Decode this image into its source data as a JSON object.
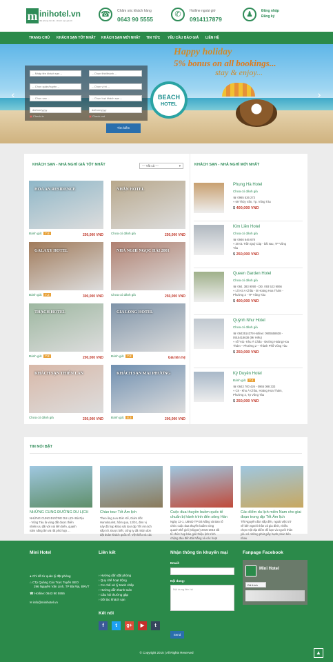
{
  "header": {
    "logo_text": "inihotel.vn",
    "logo_letter": "m",
    "logo_sub": "đặt phòng tốc độ · khách sạn giá tốt",
    "care_label": "Chăm sóc khách hàng",
    "care_phone": "0643 90 5555",
    "hotline_label": "Hotline ngoài giờ",
    "hotline_phone": "0914117879",
    "login": "Đăng nhập",
    "register": "Đăng ký",
    "icons": [
      "phone-icon",
      "mobile-phone-icon",
      "user-icon"
    ]
  },
  "nav": [
    "TRANG CHỦ",
    "KHÁCH SẠN TỐT NHẤT",
    "KHÁCH SẠN MỚI NHẤT",
    "TIN TỨC",
    "YÊU CẦU BÁO GIÁ",
    "LIÊN HỆ"
  ],
  "search": {
    "keyword_placeholder": "-- Nhập tên khách sạn --",
    "province": "-- Chọn tỉnh/thành --",
    "district": "-- Chọn quận/huyện --",
    "location": "-- Chọn vị trí --",
    "stars": "-- Chọn sao --",
    "hotel_type": "-- Chọn loại khách sạn --",
    "checkin_placeholder": "dd/mm/yyyy",
    "checkout_placeholder": "dd/mm/yyyy",
    "checkin_label": "Check-in",
    "checkout_label": "Check-out",
    "button": "Tìm kiếm"
  },
  "banner": {
    "line1": "Happy holiday",
    "line2": "5% bonus on all bookings...",
    "line3": "stay & enjoy...",
    "badge1": "BEACH",
    "badge2": "HOTEL"
  },
  "best": {
    "title": "KHÁCH SẠN - NHÀ NGHỈ GIÁ TỐT NHẤT",
    "filter": "--- Tất cả ---",
    "rate_label": "Đánh giá:",
    "hotels": [
      {
        "name": "HOA AN RESIDENCE",
        "rating": "7.8",
        "price": "250,000 VND",
        "rated": true,
        "color": "#8fb7c8"
      },
      {
        "name": "NHẬN HOTEL",
        "rating_text": "Chưa có đánh giá",
        "price": "250,000 VND",
        "rated": false,
        "color": "#b8a88c"
      },
      {
        "name": "GALAXY HOTEL",
        "rating": "7.2",
        "price": "300,000 VND",
        "rated": true,
        "color": "#a07a5a"
      },
      {
        "name": "NHÀ NGHỈ NGỌC HẢI 2001",
        "rating_text": "Chưa có đánh giá",
        "price": "250,000 VND",
        "rated": false,
        "color": "#b08070"
      },
      {
        "name": "THẠCH HOTEL",
        "rating": "7.8",
        "price": "200,000 VND",
        "rated": true,
        "color": "#9db7a0"
      },
      {
        "name": "GIA LONG HOTEL",
        "rating": "7.8",
        "price": "Giá liên hệ",
        "rated": true,
        "color": "#7e93a8"
      },
      {
        "name": "KHÁCH SẠN THIÊN LAN",
        "rating_text": "Chưa có đánh giá",
        "price": "250,000 VND",
        "rated": false,
        "color": "#d8b8a8"
      },
      {
        "name": "KHÁCH SẠN MAI PHƯƠNG",
        "rating": "8.3",
        "price": "200,000 VND",
        "rated": true,
        "color": "#6f8fb0"
      }
    ]
  },
  "newest": {
    "title": "KHÁCH SẠN - NHÀ NGHỈ MỚI NHẤT",
    "hotels": [
      {
        "name": "Phụng Hà Hotel",
        "rating_text": "Chưa có đánh giá",
        "phone": "0965 526 273",
        "address": "69 Thùy Vân, Tp. Vũng Tàu",
        "address2": "",
        "price": "400,000 VND",
        "color": "#c8a070"
      },
      {
        "name": "Kim Liên Hotel",
        "rating_text": "Chưa có đánh giá",
        "phone": "0946 646 678",
        "address": "30 01 Trần Quý Cáp - bãi sau, TP Vũng",
        "address2": "Tàu",
        "price": "250,000 VND",
        "color": "#b0b8c0"
      },
      {
        "name": "Queen Garden Hotel",
        "rating_text": "Chưa có đánh giá",
        "phone": "064. 383 9090 - DĐ. 093 523 9066",
        "address": "Lô H3 A Châu - Đ Hoàng Hoa Thám -",
        "address2": "Phường 2 - TP Vũng Tàu",
        "price": "400,000 VND",
        "color": "#9fb08a"
      },
      {
        "name": "Quỳnh Như Hotel",
        "rating_text": "Chưa có đánh giá",
        "phone": "0643514379 Hotline: 0905558638 -",
        "phone2": "0915418638 (Mr Hiếu)",
        "address": "số Y41- Khu Á Châu - Đường Hoàng Hoa",
        "address2": "Thám – Phường 2 – Thành Phố Vũng Tàu",
        "price": "250,000 VND",
        "color": "#c0c8d0"
      },
      {
        "name": "Kỳ Duyên Hotel",
        "rating": "7.4",
        "phone": "0643 700 426 - 0965 088 333",
        "address": "C8 - Khu Á Châu, Hoàng Hoa Thám,",
        "address2": "Phường 2, Tp Vũng Tàu",
        "price": "250,000 VND",
        "color": "#a8b8c8"
      }
    ]
  },
  "news": {
    "title": "TIN NỔI BẬT",
    "items": [
      {
        "title": "NHỮNG CUNG ĐƯỜNG DU LỊCH",
        "text": [
          "NHỮNG CUNG ĐƯỜNG DU LỊCH Bà Rịa",
          "- Vũng Tàu là vùng đất được thiên",
          "nhiên ưu đãi với núi liền biển, quanh",
          "năm nắng ấm và rất phù hợp ..."
        ],
        "color": "#5f8f6a"
      },
      {
        "title": "Chào tour Tết Âm lịch",
        "text": [
          "Theo ông Lưu Đức Kế, Giám đốc",
          "Hanoitourist, hôm qua, 12/01, đơn vị",
          "này đã họp khảo sát tour dịp Tết Âm lịch",
          "sắp tới. Được biết, công ty đã nhận đơn",
          "đặt đoàn khách quốc tế. Việt kiều và các"
        ],
        "color": "#8a7a5a"
      },
      {
        "title": "Cuộc đua thuyền buồm quốc tế chuẩn bị hành trình đến sông Hàn",
        "text": [
          "Ngày 12-1, UBND TP Đà Nẵng và Ban tổ",
          "chức cuộc đua thuyền buồm vòng",
          "quanh thế giới (Clipper) 2015-2016 đã",
          "tổ chức họp báo giới thiệu lịch trình",
          "chặng đua đến Đà Nẵng và các hoạt"
        ],
        "color": "#c04a3a"
      },
      {
        "title": "Các điểm du lịch miền Nam cho giai đoạn trong dịp Tết Âm lịch",
        "text": [
          "Tết Nguyên đán sắp đến, ngoài việc trở",
          "về bên người thân và gia đình, nhiều",
          "chọn một địa điểm để bạn và người thân",
          "yêu có những phút giây hạnh phúc bên",
          "nhau"
        ],
        "color": "#c8a860"
      }
    ]
  },
  "footer": {
    "col1_title": "Mini Hotel",
    "col1": [
      "Chỉ đồ từ quản lý đặt phòng",
      "CTy Quảng Cáo Trực Tuyến SEO",
      "296 Nguyễn Văn Linh, TP Bà Rịa, BRVT",
      "Hotline: 0643 90 5555",
      "info@minihotel.vn"
    ],
    "col2_title": "Liên kết",
    "col2": [
      "Hướng dẫn đặt phòng",
      "Quy chế hoạt động",
      "Cơ chế xử lý tranh chấp",
      "Hướng dẫn thanh toán",
      "Câu hỏi thường gặp",
      "Đối tác khách sạn"
    ],
    "social_title": "Kết nối",
    "social": [
      "f",
      "t",
      "g+",
      "▶",
      "t"
    ],
    "social_colors": [
      "#3b5998",
      "#1da1f2",
      "#dd4b39",
      "#c4302b",
      "#35465c"
    ],
    "col3_title": "Nhận thông tin khuyến mại",
    "email_label": "Email:",
    "content_label": "Nội dung:",
    "content_placeholder": "Nội dung liên hệ",
    "send": "Send",
    "col4_title": "Fanpage Facebook",
    "fb_name": "Mini Hotel",
    "fb_liked": "Đã thích",
    "copyright": "© Copyright 2015 | All Rights Reserved"
  },
  "colors": {
    "primary": "#2b8a4a",
    "price": "#c0392b",
    "badge": "#e8a23a"
  }
}
